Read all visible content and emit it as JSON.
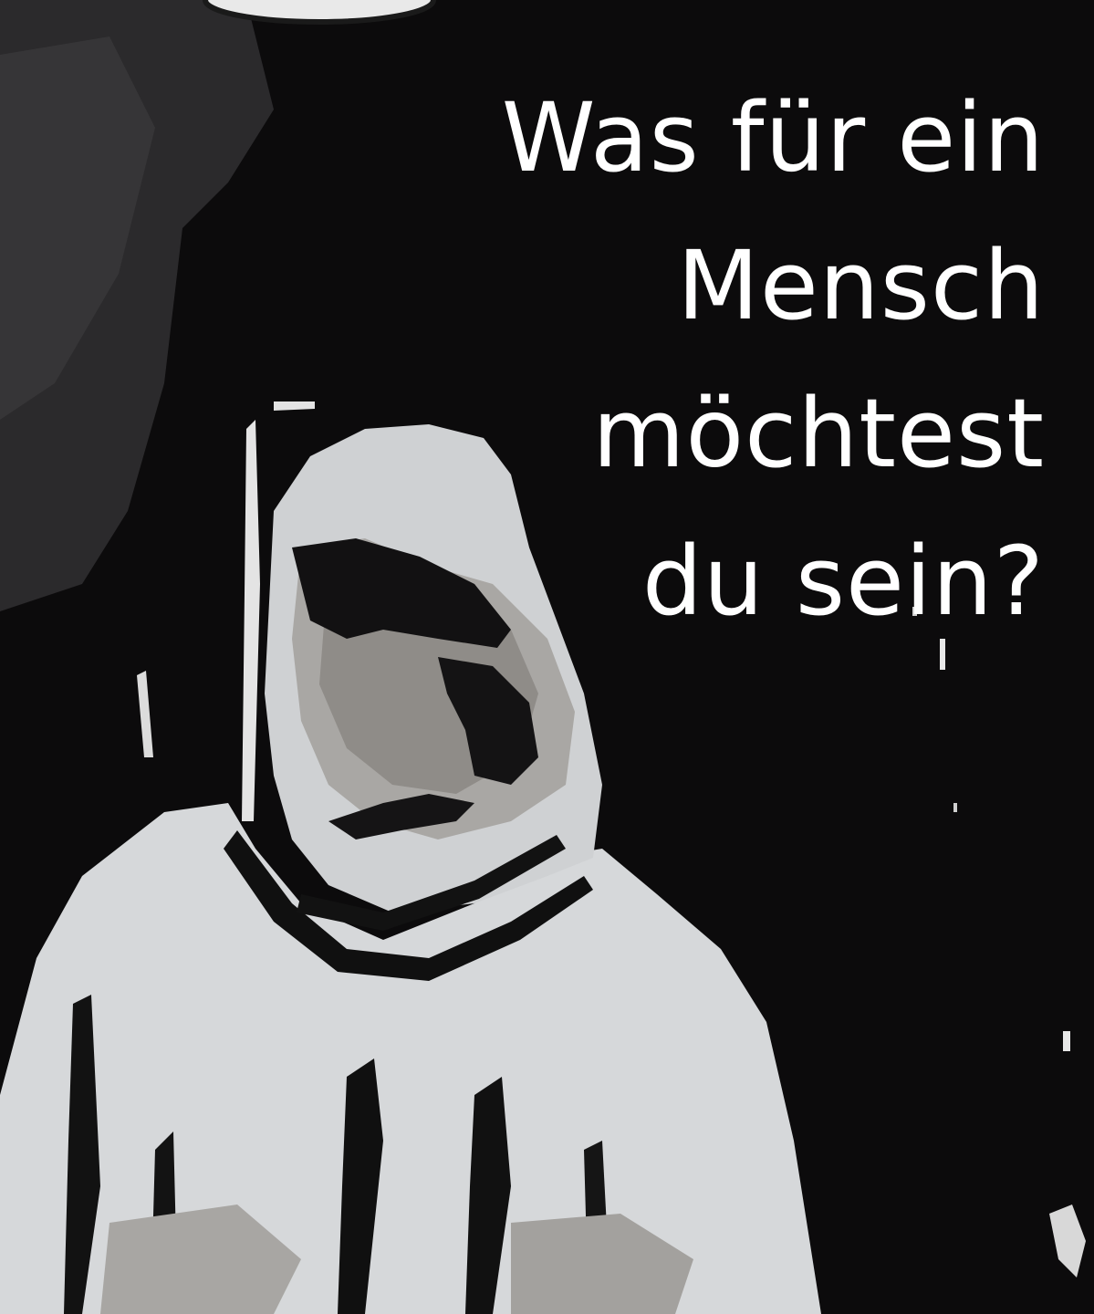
{
  "poster": {
    "headline_lines": [
      "Was für ein",
      "Mensch",
      "möchtest",
      "du sein?"
    ]
  },
  "colors": {
    "background": "#0b0a0b",
    "text": "#ffffff",
    "figure_light": "#d9dbdc",
    "figure_shadow": "#9d9b98"
  }
}
